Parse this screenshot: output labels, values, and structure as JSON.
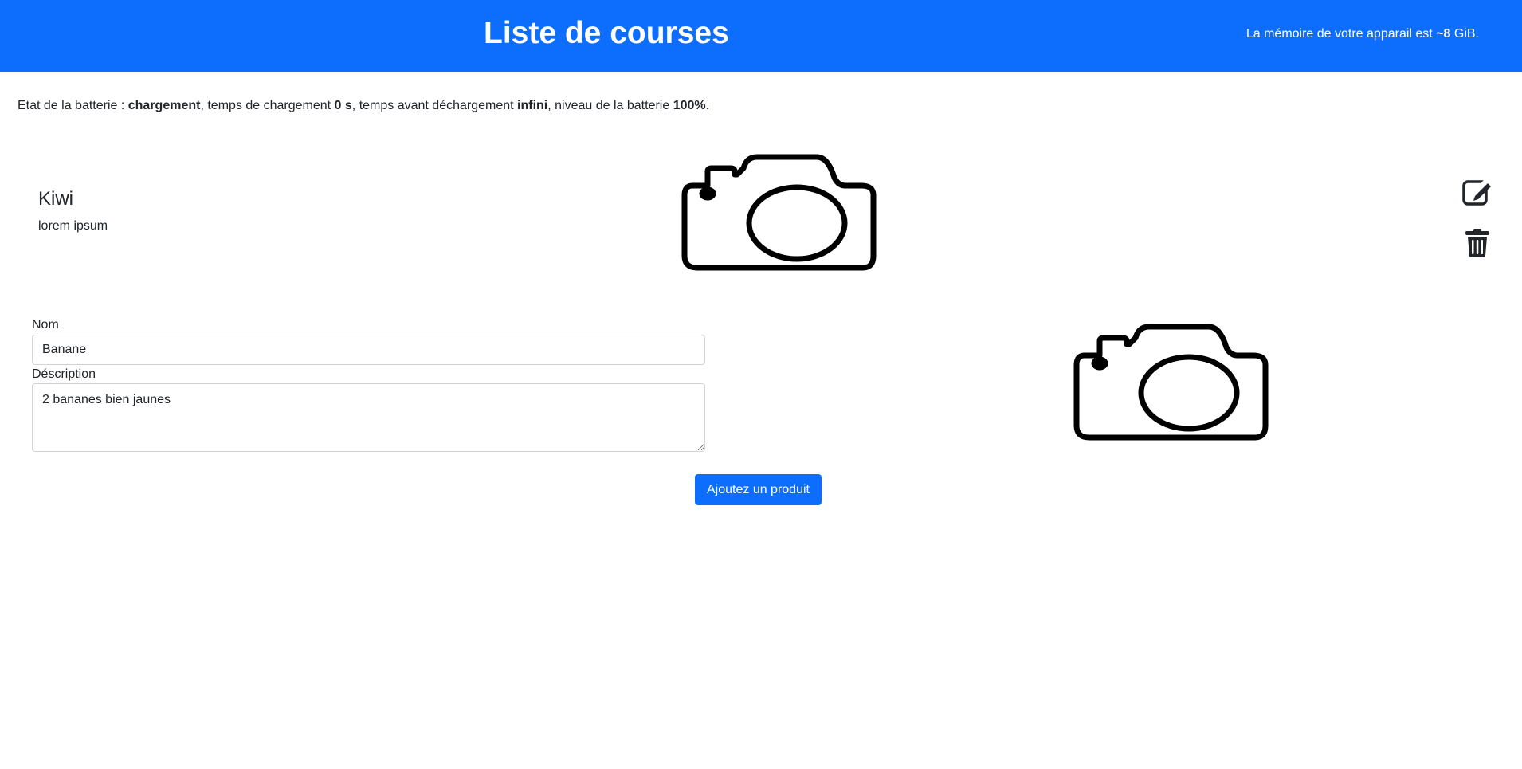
{
  "header": {
    "title": "Liste de courses",
    "memory": {
      "prefix": "La mémoire de votre apparail est ",
      "value": "~8",
      "suffix": " GiB."
    },
    "background_color": "#0d6efd"
  },
  "battery": {
    "label": "Etat de la batterie : ",
    "state": "chargement",
    "charge_time_label": ", temps de chargement ",
    "charge_time": "0 s",
    "discharge_label": ", temps avant déchargement ",
    "discharge_time": "infini",
    "level_label": ", niveau de la batterie ",
    "level": "100%",
    "end": "."
  },
  "items": [
    {
      "name": "Kiwi",
      "description": "lorem ipsum",
      "image_icon": "camera-icon"
    }
  ],
  "item_actions": {
    "edit_icon": "edit-icon",
    "delete_icon": "trash-icon"
  },
  "form": {
    "name_label": "Nom",
    "name_value": "Banane",
    "description_label": "Déscription",
    "description_value": "2 bananes bien jaunes",
    "image_icon": "camera-icon",
    "submit_label": "Ajoutez un produit"
  }
}
